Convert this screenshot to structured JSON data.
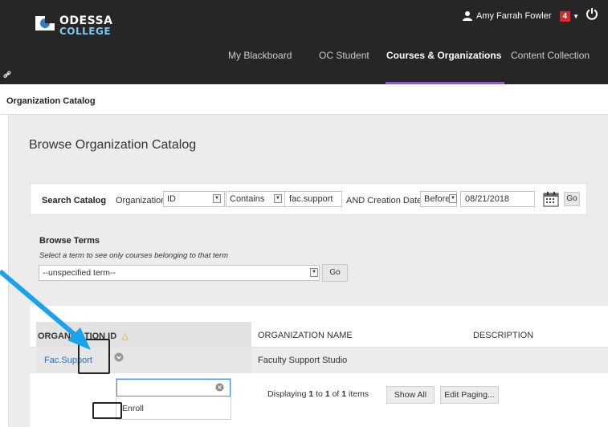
{
  "header": {
    "logo_line1": "ODESSA",
    "logo_line2": "COLLEGE",
    "user_name": "Amy Farrah Fowler",
    "notification_count": "4",
    "nav": [
      {
        "label": "My Blackboard"
      },
      {
        "label": "OC Student"
      },
      {
        "label": "Courses & Organizations"
      },
      {
        "label": "Content Collection"
      }
    ]
  },
  "breadcrumb": "Organization Catalog",
  "page_title": "Browse Organization Catalog",
  "search": {
    "label": "Search Catalog",
    "field_label": "Organization",
    "field_select": "ID",
    "operator_select": "Contains",
    "query": "fac.support",
    "date_label": "AND Creation Date",
    "date_op": "Before",
    "date_value": "08/21/2018",
    "go": "Go"
  },
  "browse_terms": {
    "title": "Browse Terms",
    "subtitle": "Select a term to see only courses belonging to that term",
    "selected": "--unspecified term--",
    "go": "Go"
  },
  "table": {
    "columns": [
      "ORGANIZATION ID",
      "ORGANIZATION NAME",
      "DESCRIPTION"
    ],
    "rows": [
      {
        "id": "Fac.Support",
        "name": "Faculty Support Studio",
        "description": ""
      }
    ]
  },
  "menu": {
    "enroll": "Enroll"
  },
  "paging": {
    "prefix": "Displaying",
    "from": "1",
    "to_word": "to",
    "to": "1",
    "of_word": "of",
    "total": "1",
    "suffix": "items",
    "show_all": "Show All",
    "edit_paging": "Edit Paging..."
  },
  "colors": {
    "header_bg": "#262626",
    "nav_active_underline": "#8a5cc4",
    "notification": "#d9262a",
    "link": "#2a6fb5",
    "annotation_arrow": "#1aa3e8"
  }
}
